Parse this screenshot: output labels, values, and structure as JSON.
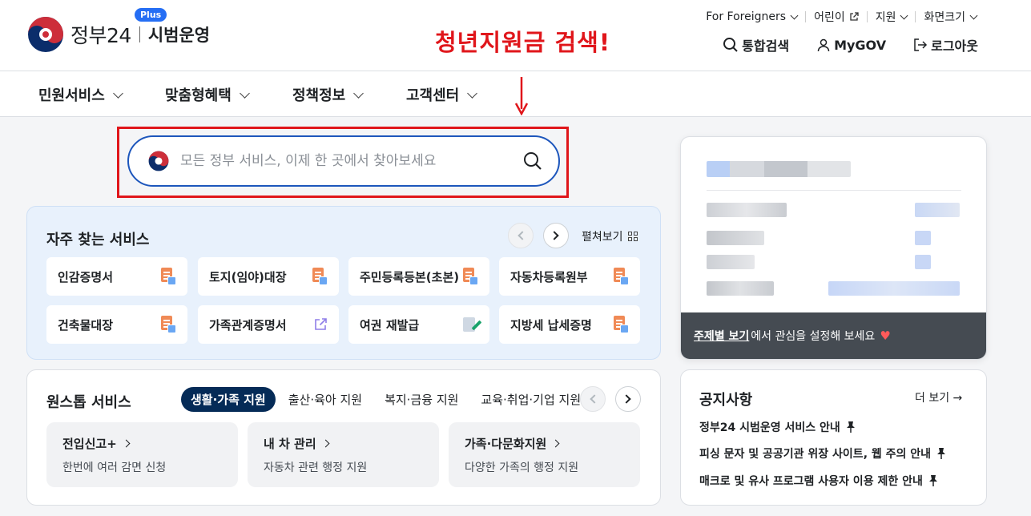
{
  "header": {
    "logo_text": "정부24",
    "logo_sub": "시범운영",
    "plus_badge": "Plus",
    "annotation": "청년지원금 검색!",
    "util_links": [
      {
        "label": "For Foreigners"
      },
      {
        "label": "어린이"
      },
      {
        "label": "지원"
      },
      {
        "label": "화면크기"
      }
    ],
    "actions": {
      "search": "통합검색",
      "mygov": "MyGOV",
      "logout": "로그아웃"
    }
  },
  "gnb": {
    "items": [
      "민원서비스",
      "맞춤형혜택",
      "정책정보",
      "고객센터"
    ]
  },
  "search": {
    "placeholder": "모든 정부 서비스, 이제 한 곳에서 찾아보세요"
  },
  "favorites": {
    "title": "자주 찾는 서비스",
    "expand_label": "펼쳐보기",
    "items": [
      {
        "label": "인감증명서",
        "icon": "document-icon"
      },
      {
        "label": "토지(임야)대장",
        "icon": "document-icon"
      },
      {
        "label": "주민등록등본(초본)",
        "icon": "document-icon"
      },
      {
        "label": "자동차등록원부",
        "icon": "document-icon"
      },
      {
        "label": "건축물대장",
        "icon": "document-icon"
      },
      {
        "label": "가족관계증명서",
        "icon": "external-link-icon"
      },
      {
        "label": "여권 재발급",
        "icon": "edit-document-icon"
      },
      {
        "label": "지방세 납세증명",
        "icon": "document-icon"
      }
    ]
  },
  "onestop": {
    "title": "원스톱 서비스",
    "tabs": [
      "생활·가족 지원",
      "출산·육아 지원",
      "복지·금융 지원",
      "교육·취업·기업 지원"
    ],
    "active_tab": 0,
    "cards": [
      {
        "title": "전입신고+",
        "desc": "한번에 여러 감면 신청"
      },
      {
        "title": "내 차 관리",
        "desc": "자동차 관련 행정 지원"
      },
      {
        "title": "가족·다문화지원",
        "desc": "다양한 가족의 행정 지원"
      }
    ]
  },
  "user_panel": {
    "topic_link": "주제별 보기",
    "topic_text": "에서 관심을 설정해 보세요"
  },
  "notice": {
    "title": "공지사항",
    "more": "더 보기",
    "items": [
      "정부24 시범운영 서비스 안내",
      "피싱 문자 및 공공기관 위장 사이트, 웹 주의 안내",
      "매크로 및 유사 프로그램 사용자 이용 제한 안내"
    ]
  },
  "colors": {
    "brand_blue": "#1d56bc",
    "annotation_red": "#e0161b",
    "active_tab": "#052b57"
  }
}
